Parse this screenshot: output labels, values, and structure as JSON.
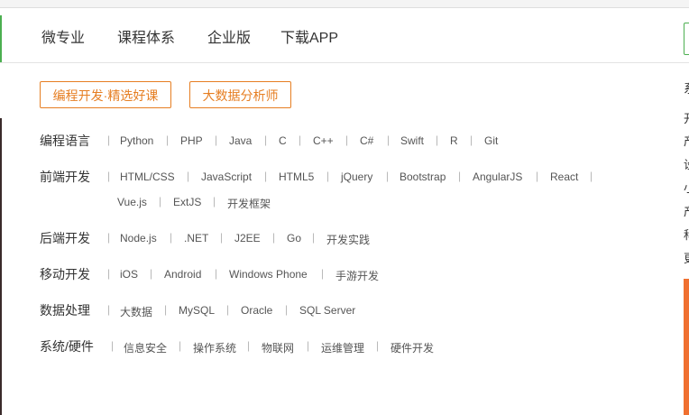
{
  "nav": {
    "items": [
      "微专业",
      "课程体系",
      "企业版",
      "下载APP"
    ]
  },
  "tags": [
    "编程开发·精选好课",
    "大数据分析师"
  ],
  "categories": [
    {
      "label": "编程语言",
      "items": [
        "Python",
        "PHP",
        "Java",
        "C",
        "C++",
        "C#",
        "Swift",
        "R",
        "Git"
      ]
    },
    {
      "label": "前端开发",
      "items": [
        "HTML/CSS",
        "JavaScript",
        "HTML5",
        "jQuery",
        "Bootstrap",
        "AngularJS",
        "React",
        "Vue.js",
        "ExtJS",
        "开发框架"
      ]
    },
    {
      "label": "后端开发",
      "items": [
        "Node.js",
        ".NET",
        "J2EE",
        "Go",
        "开发实践"
      ]
    },
    {
      "label": "移动开发",
      "items": [
        "iOS",
        "Android",
        "Windows Phone",
        "手游开发"
      ]
    },
    {
      "label": "数据处理",
      "items": [
        "大数据",
        "MySQL",
        "Oracle",
        "SQL Server"
      ]
    },
    {
      "label": "系统/硬件",
      "items": [
        "信息安全",
        "操作系统",
        "物联网",
        "运维管理",
        "硬件开发"
      ]
    }
  ],
  "side_chars": [
    "系",
    "开",
    "产",
    "设",
    "小",
    "产",
    "科",
    "更"
  ],
  "colors": {
    "accent_green": "#4caf50",
    "accent_orange": "#e67e22",
    "side_orange": "#f07030"
  }
}
